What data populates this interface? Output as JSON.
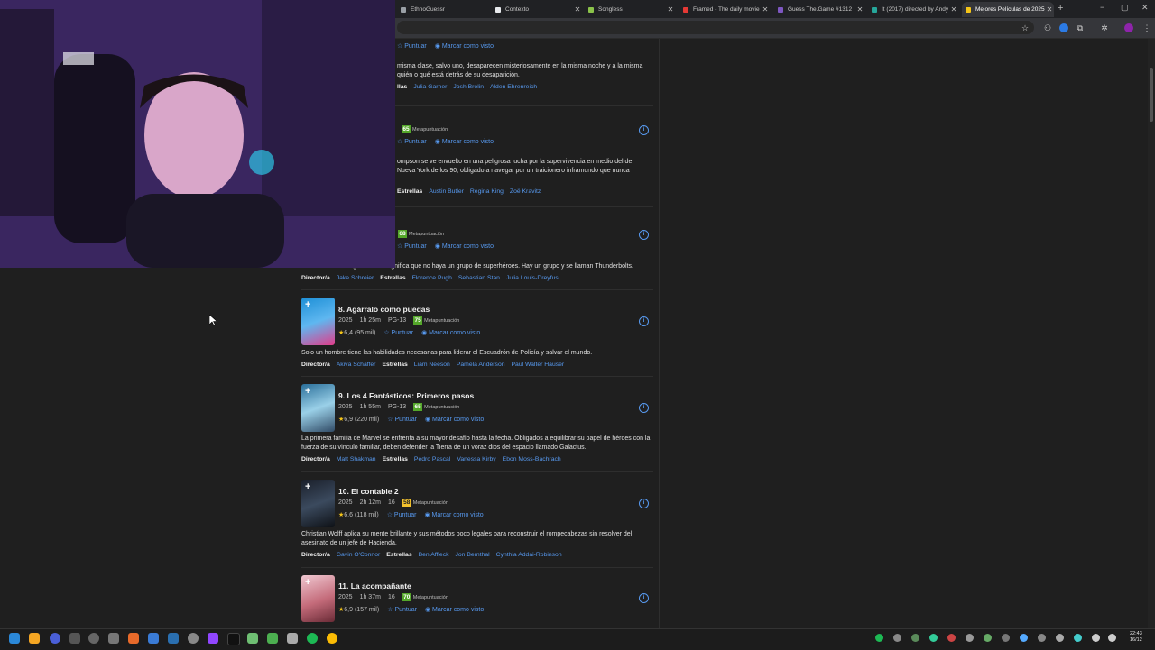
{
  "browser": {
    "tabs": [
      {
        "title": "EthnoGuessr",
        "active": false,
        "color": "#9aa0a6"
      },
      {
        "title": "Contexto",
        "active": false,
        "color": "#e8eaed"
      },
      {
        "title": "Songless",
        "active": false,
        "color": "#8bc34a"
      },
      {
        "title": "Framed - The daily movie",
        "active": false,
        "color": "#e53935"
      },
      {
        "title": "Guess The.Game #1312",
        "active": false,
        "color": "#7e57c2"
      },
      {
        "title": "It (2017) directed by Andy",
        "active": false,
        "color": "#26a69a"
      },
      {
        "title": "Mejores Películas de 2025",
        "active": true,
        "color": "#f5c518"
      }
    ],
    "new_tab": "+",
    "window_controls": [
      "−",
      "▢",
      "✕"
    ]
  },
  "labels": {
    "rate": "Puntuar",
    "mark_watched": "Marcar como visto",
    "metascore": "Metapuntuación",
    "director": "Director/a",
    "stars": "Estrellas",
    "add": "+",
    "info": "i"
  },
  "partials": [
    {
      "desc": "misma clase, salvo uno, desaparecen misteriosamente en la misma noche y a la misma quién o qué está detrás de su desaparición.",
      "stars_label": "llas",
      "stars": [
        "Julia Garner",
        "Josh Brolin",
        "Alden Ehrenreich"
      ]
    },
    {
      "metascore": "65",
      "desc": "ompson se ve envuelto en una peligrosa lucha por la supervivencia en medio del de Nueva York de los 90, obligado a navegar por un traicionero inframundo que nunca",
      "stars_label": "Estrellas",
      "stars": [
        "Austin Butler",
        "Regina King",
        "Zoë Kravitz"
      ]
    },
    {
      "metascore": "68",
      "desc": "Un mundo sin Vengadores no significa que no haya un grupo de superhéroes. Hay un grupo y se llaman Thunderbolts.",
      "director": "Jake Schreier",
      "stars": [
        "Florence Pugh",
        "Sebastian Stan",
        "Julia Louis-Dreyfus"
      ]
    }
  ],
  "movies": [
    {
      "title": "8. Agárralo como puedas",
      "year": "2025",
      "duration": "1h 25m",
      "rating_cert": "PG-13",
      "metascore": "75",
      "ms_color": "#54a72a",
      "user_rating": "6,4",
      "votes": "(95 mil)",
      "desc": "Solo un hombre tiene las habilidades necesarias para liderar el Escuadrón de Policía y salvar el mundo.",
      "director": "Akiva Schaffer",
      "stars": [
        "Liam Neeson",
        "Pamela Anderson",
        "Paul Walter Hauser"
      ]
    },
    {
      "title": "9. Los 4 Fantásticos: Primeros pasos",
      "year": "2025",
      "duration": "1h 55m",
      "rating_cert": "PG-13",
      "metascore": "65",
      "ms_color": "#54a72a",
      "user_rating": "6,9",
      "votes": "(220 mil)",
      "desc": "La primera familia de Marvel se enfrenta a su mayor desafío hasta la fecha. Obligados a equilibrar su papel de héroes con la fuerza de su vínculo familiar, deben defender la Tierra de un voraz dios del espacio llamado Galactus.",
      "director": "Matt Shakman",
      "stars": [
        "Pedro Pascal",
        "Vanessa Kirby",
        "Ebon Moss-Bachrach"
      ]
    },
    {
      "title": "10. El contable 2",
      "year": "2025",
      "duration": "2h 12m",
      "rating_cert": "16",
      "metascore": "58",
      "ms_color": "#f2c12e",
      "user_rating": "6,6",
      "votes": "(118 mil)",
      "desc": "Christian Wolff aplica su mente brillante y sus métodos poco legales para reconstruir el rompecabezas sin resolver del asesinato de un jefe de Hacienda.",
      "director": "Gavin O'Connor",
      "stars": [
        "Ben Affleck",
        "Jon Bernthal",
        "Cynthia Addai-Robinson"
      ]
    },
    {
      "title": "11. La acompañante",
      "year": "2025",
      "duration": "1h 37m",
      "rating_cert": "16",
      "metascore": "70",
      "ms_color": "#54a72a",
      "user_rating": "6,9",
      "votes": "(157 mil)"
    }
  ],
  "clock": {
    "time": "22:43",
    "date": "16/12"
  }
}
